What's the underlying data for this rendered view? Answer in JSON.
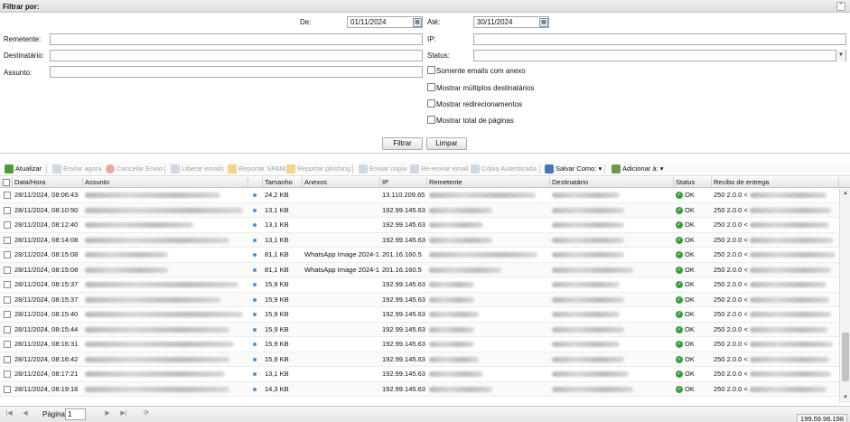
{
  "filter": {
    "title": "Filtrar por:",
    "de_label": "De:",
    "de_value": "01/11/2024",
    "ate_label": "Até:",
    "ate_value": "30/11/2024",
    "remetente_label": "Remetente:",
    "ip_label": "IP:",
    "destinatario_label": "Destinatário:",
    "status_label": "Status:",
    "assunto_label": "Assunto:",
    "checks": [
      "Somente emails com anexo",
      "Mostrar múltiplos destinatários",
      "Mostrar redirecionamentos",
      "Mostrar total de páginas"
    ],
    "filtrar_button": "Filtrar",
    "limpar_button": "Limpar"
  },
  "toolbar": {
    "atualizar": "Atualizar",
    "enviar_agora": "Enviar agora",
    "cancelar_envio": "Cancelar Envio",
    "liberar_emails": "Liberar emails",
    "reportar_spam": "Reportar SPAM",
    "reportar_phishing": "Reportar phishing",
    "enviar_copia": "Enviar cópia",
    "reenviar_email": "Re-enviar email",
    "copia_autenticada": "Cópia Autenticada",
    "salvar_como": "Salvar Como:",
    "adicionar_a": "Adicionar à:"
  },
  "columns": {
    "data_hora": "Data/Hora",
    "assunto": "Assunto",
    "tamanho": "Tamanho",
    "anexos": "Anexos",
    "ip": "IP",
    "remetente": "Remetente",
    "destinatario": "Destinatário",
    "status": "Status",
    "recibo": "Recibo de entrega"
  },
  "rows": [
    {
      "date": "28/11/2024, 08:06:43",
      "size": "24,2 KB",
      "attach": "",
      "ip": "13.110.209.65",
      "status": "OK",
      "receipt": "250 2.0.0 <"
    },
    {
      "date": "28/11/2024, 08:10:50",
      "size": "13,1 KB",
      "attach": "",
      "ip": "192.99.145.63",
      "status": "OK",
      "receipt": "250 2.0.0 <"
    },
    {
      "date": "28/11/2024, 08:12:40",
      "size": "13,1 KB",
      "attach": "",
      "ip": "192.99.145.63",
      "status": "OK",
      "receipt": "250 2.0.0 <"
    },
    {
      "date": "28/11/2024, 08:14:08",
      "size": "13,1 KB",
      "attach": "",
      "ip": "192.99.145.63",
      "status": "OK",
      "receipt": "250 2.0.0 <"
    },
    {
      "date": "28/11/2024, 08:15:08",
      "size": "81,1 KB",
      "attach": "WhatsApp Image 2024-1...",
      "ip": "201.16.160.5",
      "status": "OK",
      "receipt": "250 2.0.0 <"
    },
    {
      "date": "28/11/2024, 08:15:08",
      "size": "81,1 KB",
      "attach": "WhatsApp Image 2024-1...",
      "ip": "201.16.160.5",
      "status": "OK",
      "receipt": "250 2.0.0 <"
    },
    {
      "date": "28/11/2024, 08:15:37",
      "size": "15,9 KB",
      "attach": "",
      "ip": "192.99.145.63",
      "status": "OK",
      "receipt": "250 2.0.0 <"
    },
    {
      "date": "28/11/2024, 08:15:37",
      "size": "15,9 KB",
      "attach": "",
      "ip": "192.99.145.63",
      "status": "OK",
      "receipt": "250 2.0.0 <"
    },
    {
      "date": "28/11/2024, 08:15:40",
      "size": "15,9 KB",
      "attach": "",
      "ip": "192.99.145.63",
      "status": "OK",
      "receipt": "250 2.0.0 <"
    },
    {
      "date": "28/11/2024, 08:15:44",
      "size": "15,9 KB",
      "attach": "",
      "ip": "192.99.145.63",
      "status": "OK",
      "receipt": "250 2.0.0 <"
    },
    {
      "date": "28/11/2024, 08:16:31",
      "size": "15,9 KB",
      "attach": "",
      "ip": "192.99.145.63",
      "status": "OK",
      "receipt": "250 2.0.0 <"
    },
    {
      "date": "28/11/2024, 08:16:42",
      "size": "15,9 KB",
      "attach": "",
      "ip": "192.99.145.63",
      "status": "OK",
      "receipt": "250 2.0.0 <"
    },
    {
      "date": "28/11/2024, 08:17:21",
      "size": "13,1 KB",
      "attach": "",
      "ip": "192.99.145.63",
      "status": "OK",
      "receipt": "250 2.0.0 <"
    },
    {
      "date": "28/11/2024, 08:19:16",
      "size": "14,3 KB",
      "attach": "",
      "ip": "192.99.145.63",
      "status": "OK",
      "receipt": "250 2.0.0 <"
    }
  ],
  "pager": {
    "page_label": "Página",
    "page_value": "1"
  },
  "client_ip": "199.59.96.198"
}
